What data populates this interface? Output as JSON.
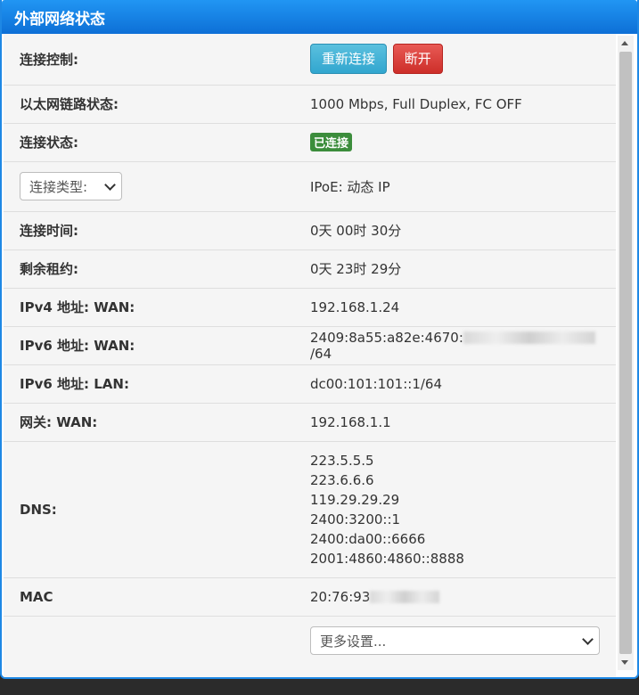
{
  "panel": {
    "title": "外部网络状态"
  },
  "rows": {
    "control": {
      "label": "连接控制:",
      "reconnect": "重新连接",
      "disconnect": "断开"
    },
    "ethernet": {
      "label": "以太网链路状态:",
      "value": "1000 Mbps, Full Duplex, FC OFF"
    },
    "status": {
      "label": "连接状态:",
      "badge": "已连接"
    },
    "type": {
      "select": "连接类型:",
      "value": "IPoE: 动态 IP"
    },
    "uptime": {
      "label": "连接时间:",
      "value": "0天 00时 30分"
    },
    "lease": {
      "label": "剩余租约:",
      "value": "0天 23时 29分"
    },
    "ipv4_wan": {
      "label": "IPv4 地址: WAN:",
      "value": "192.168.1.24"
    },
    "ipv6_wan": {
      "label": "IPv6 地址: WAN:",
      "prefix": "2409:8a55:a82e:4670:",
      "suffix": "/64"
    },
    "ipv6_lan": {
      "label": "IPv6 地址: LAN:",
      "value": "dc00:101:101::1/64"
    },
    "gateway": {
      "label": "网关: WAN:",
      "value": "192.168.1.1"
    },
    "dns": {
      "label": "DNS:",
      "servers": [
        "223.5.5.5",
        "223.6.6.6",
        "119.29.29.29",
        "2400:3200::1",
        "2400:da00::6666",
        "2001:4860:4860::8888"
      ]
    },
    "mac": {
      "label": "MAC",
      "prefix": "20:76:93"
    },
    "more": {
      "select": "更多设置..."
    }
  },
  "colors": {
    "title_bar": "#1e88e5",
    "reconnect": "#31a6cf",
    "disconnect": "#cd2e29",
    "badge": "#3c8d3c"
  }
}
